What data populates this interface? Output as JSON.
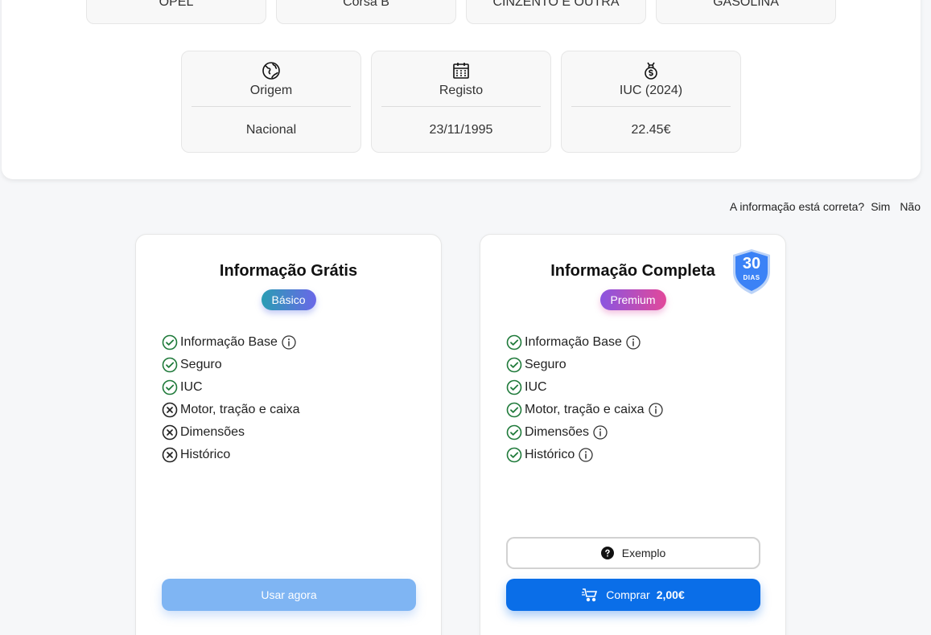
{
  "vehicle": {
    "brand": "OPEL",
    "model": "Corsa B",
    "color": "CINZENTO E OUTRA",
    "fuel": "GASOLINA",
    "origin": {
      "label": "Origem",
      "value": "Nacional",
      "icon": "globe-icon"
    },
    "registration": {
      "label": "Registo",
      "value": "23/11/1995",
      "icon": "calendar-icon"
    },
    "iuc": {
      "label": "IUC (2024)",
      "value": "22.45€",
      "icon": "money-bag-icon"
    }
  },
  "feedback": {
    "question": "A informação está correta?",
    "yes": "Sim",
    "no": "Não"
  },
  "free_plan": {
    "title": "Informação Grátis",
    "badge": "Básico",
    "features": [
      {
        "label": "Informação Base",
        "included": true,
        "info": true
      },
      {
        "label": "Seguro",
        "included": true,
        "info": false
      },
      {
        "label": "IUC",
        "included": true,
        "info": false
      },
      {
        "label": "Motor, tração e caixa",
        "included": false,
        "info": false
      },
      {
        "label": "Dimensões",
        "included": false,
        "info": false
      },
      {
        "label": "Histórico",
        "included": false,
        "info": false
      }
    ],
    "button": "Usar agora"
  },
  "premium_plan": {
    "title": "Informação Completa",
    "badge": "Premium",
    "guarantee_number": "30",
    "guarantee_unit": "DIAS",
    "features": [
      {
        "label": "Informação Base",
        "included": true,
        "info": true
      },
      {
        "label": "Seguro",
        "included": true,
        "info": false
      },
      {
        "label": "IUC",
        "included": true,
        "info": false
      },
      {
        "label": "Motor, tração e caixa",
        "included": true,
        "info": true
      },
      {
        "label": "Dimensões",
        "included": true,
        "info": true
      },
      {
        "label": "Histórico",
        "included": true,
        "info": true
      }
    ],
    "example_button": "Exemplo",
    "buy_button": "Comprar",
    "price": "2,00€"
  },
  "colors": {
    "primary": "#0a6ee8",
    "primary_light": "#7fb5f3",
    "check_green": "#1f7a3a",
    "shield_blue": "#3b82f6"
  }
}
